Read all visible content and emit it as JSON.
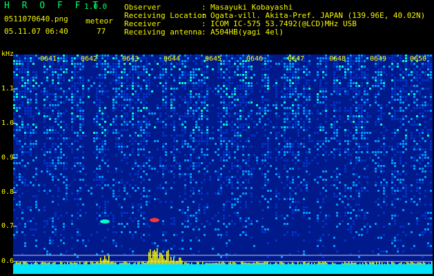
{
  "header": {
    "app_title": "H R O F F T",
    "app_version": "1.0.0",
    "file_name": "0511070640.png",
    "meteor_label": "meteor",
    "date_time": "05.11.07 06:40",
    "meteor_count": "77",
    "info": [
      {
        "key": "Observer",
        "value": "Masayuki Kobayashi"
      },
      {
        "key": "Receiving Location",
        "value": "Ogata-vill. Akita-Pref. JAPAN (139.96E, 40.02N)"
      },
      {
        "key": "Receiver",
        "value": "ICOM IC-575 53.7492(@LCD)MHz USB"
      },
      {
        "key": "Receiving antenna",
        "value": "A504HB(yagi 4el)"
      }
    ],
    "separator": ":"
  },
  "spectrogram": {
    "y_unit": "kHz",
    "y_ticks": [
      "1.1",
      "1.0",
      "0.9",
      "0.8",
      "0.7",
      "0.6"
    ],
    "x_ticks": [
      "0641",
      "0642",
      "0643",
      "0644",
      "0645",
      "0646",
      "0647",
      "0648",
      "0649",
      "0650"
    ],
    "colors": {
      "background": "#001a8c",
      "noise_low": "#0033cc",
      "noise_mid": "#0099ff",
      "noise_high": "#00ffcc",
      "accent": "#ffff00",
      "meteor": "#ff3333"
    }
  }
}
